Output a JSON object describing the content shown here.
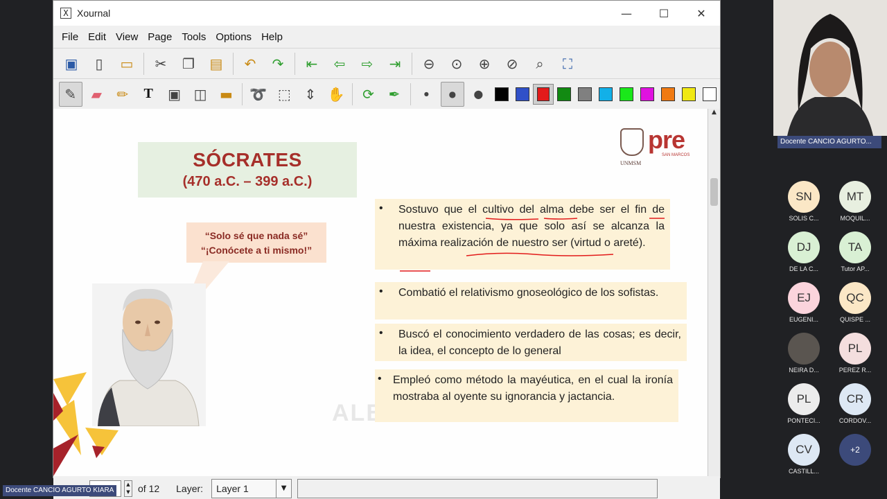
{
  "window": {
    "title": "Xournal",
    "minimize": "—",
    "maximize": "☐",
    "close": "✕"
  },
  "menu": [
    "File",
    "Edit",
    "View",
    "Page",
    "Tools",
    "Options",
    "Help"
  ],
  "colors": [
    "#000000",
    "#3050c8",
    "#e21a1a",
    "#128a12",
    "#808080",
    "#12b0e8",
    "#1ae81a",
    "#e012e0",
    "#f07a12",
    "#f0e812",
    "#ffffff"
  ],
  "status": {
    "of_label": "of 12",
    "layer_label": "Layer:",
    "layer_value": "Layer 1"
  },
  "slide": {
    "title": "SÓCRATES",
    "dates": "(470 a.C. – 399 a.C.)",
    "logo_pre": "pre",
    "logo_sm": "SAN MARCOS",
    "logo_unmsm": "UNMSM",
    "quote_1": "“Solo sé que nada sé”",
    "quote_2": "“¡Conócete a ti mismo!”",
    "watermark": "ALBERTO CRUZ",
    "bullet_mark": "•",
    "bullets": [
      "Sostuvo que el cultivo del alma debe ser el fin de nuestra existencia, ya que solo así se alcanza la máxima realización de nuestro ser (virtud o areté).",
      "Combatió el relativismo gnoseológico de los sofistas.",
      "Buscó el conocimiento verdadero de las cosas; es decir, la idea, el concepto de lo general",
      "Empleó como método la mayéutica, en el cual la ironía mostraba al oyente su ignorancia y jactancia."
    ]
  },
  "meeting": {
    "presenter": "Docente CANCIO AGURTO...",
    "bottom_label": "Docente CANCIO AGURTO KIARA",
    "participants": [
      {
        "initials": "SN",
        "name": "SOLIS C...",
        "color": "#fbe7c6"
      },
      {
        "initials": "MT",
        "name": "MOQUIL...",
        "color": "#e8efe0"
      },
      {
        "initials": "DJ",
        "name": "DE LA C...",
        "color": "#d9f0d4"
      },
      {
        "initials": "TA",
        "name": "Tutor AP...",
        "color": "#d9f0d4"
      },
      {
        "initials": "EJ",
        "name": "EUGENI...",
        "color": "#fbd4dc"
      },
      {
        "initials": "QC",
        "name": "QUISPE ...",
        "color": "#fbe7c6"
      },
      {
        "initials": "",
        "name": "NEIRA D...",
        "color": "#5a5550"
      },
      {
        "initials": "PL",
        "name": "PEREZ R...",
        "color": "#f4dede"
      },
      {
        "initials": "PL",
        "name": "PONTECI...",
        "color": "#ececec"
      },
      {
        "initials": "CR",
        "name": "CORDOV...",
        "color": "#dde8f4"
      },
      {
        "initials": "CV",
        "name": "CASTILL...",
        "color": "#dde8f4"
      },
      {
        "initials": "+2",
        "name": "",
        "color": "#3c4a7a"
      }
    ]
  }
}
